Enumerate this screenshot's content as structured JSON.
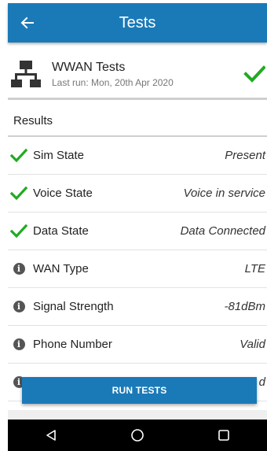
{
  "app_bar": {
    "title": "Tests",
    "back_icon": "arrow-left-icon",
    "color": "#1a7ab8"
  },
  "summary": {
    "name": "WWAN Tests",
    "last_run": "Last run: Mon, 20th Apr 2020",
    "status_icon": "check-icon",
    "status_color": "#22aa22"
  },
  "results_header": "Results",
  "results": [
    {
      "label": "Sim State",
      "value": "Present",
      "icon": "check-icon"
    },
    {
      "label": "Voice State",
      "value": "Voice in service",
      "icon": "check-icon"
    },
    {
      "label": "Data State",
      "value": "Data Connected",
      "icon": "check-icon"
    },
    {
      "label": "WAN Type",
      "value": "LTE",
      "icon": "info-icon"
    },
    {
      "label": "Signal Strength",
      "value": "-81dBm",
      "icon": "info-icon"
    },
    {
      "label": "Phone Number",
      "value": "Valid",
      "icon": "info-icon"
    },
    {
      "label": "",
      "value": "d",
      "icon": "info-icon"
    }
  ],
  "run_button": {
    "label": "RUN TESTS"
  },
  "nav": {
    "back": "nav-back-icon",
    "home": "nav-home-icon",
    "recents": "nav-recents-icon"
  }
}
